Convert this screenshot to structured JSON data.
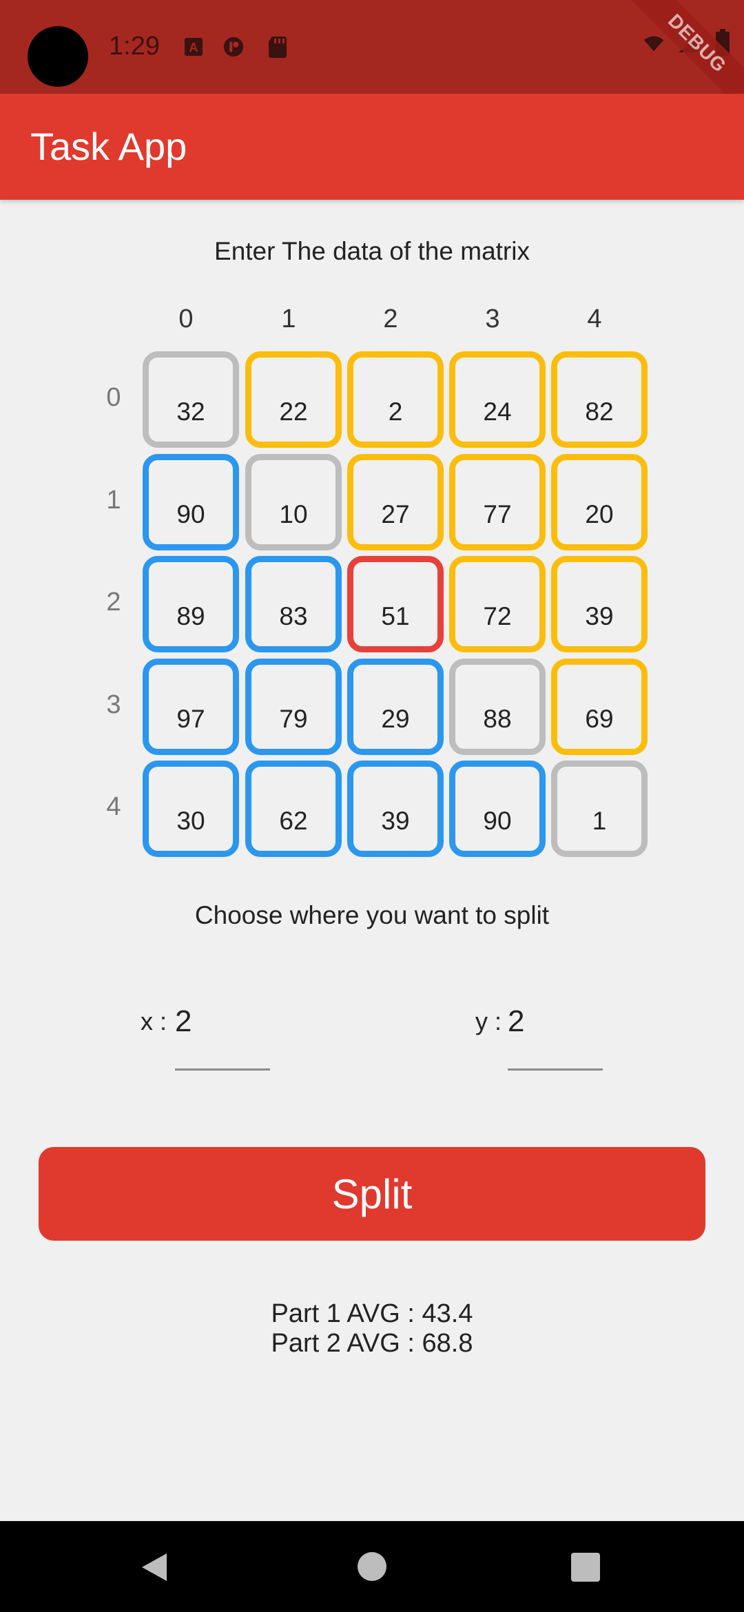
{
  "status_bar": {
    "time": "1:29",
    "left_icons": [
      "a-box-icon",
      "circle-app-icon",
      "sd-card-icon"
    ],
    "right_icons": [
      "wifi-icon",
      "signal-icon",
      "battery-icon"
    ],
    "debug_ribbon": "DEBUG"
  },
  "app_bar": {
    "title": "Task App"
  },
  "matrix": {
    "prompt": "Enter The data of the matrix",
    "column_labels": [
      "0",
      "1",
      "2",
      "3",
      "4"
    ],
    "row_labels": [
      "0",
      "1",
      "2",
      "3",
      "4"
    ],
    "rows": [
      [
        "32",
        "22",
        "2",
        "24",
        "82"
      ],
      [
        "90",
        "10",
        "27",
        "77",
        "20"
      ],
      [
        "89",
        "83",
        "51",
        "72",
        "39"
      ],
      [
        "97",
        "79",
        "29",
        "88",
        "69"
      ],
      [
        "30",
        "62",
        "39",
        "90",
        "1"
      ]
    ],
    "cell_colors": [
      [
        "gray",
        "yellow",
        "yellow",
        "yellow",
        "yellow"
      ],
      [
        "blue",
        "gray",
        "yellow",
        "yellow",
        "yellow"
      ],
      [
        "blue",
        "blue",
        "red",
        "yellow",
        "yellow"
      ],
      [
        "blue",
        "blue",
        "blue",
        "gray",
        "yellow"
      ],
      [
        "blue",
        "blue",
        "blue",
        "blue",
        "gray"
      ]
    ],
    "colors": {
      "gray": "#bdbdbd",
      "yellow": "#fbbd0d",
      "blue": "#2b97ee",
      "red": "#e6413a"
    }
  },
  "split": {
    "prompt": "Choose where you want to split",
    "x_label": "x :",
    "x_value": "2",
    "y_label": "y :",
    "y_value": "2",
    "button_label": "Split"
  },
  "results": {
    "part1": "Part 1 AVG : 43.4",
    "part2": "Part 2 AVG : 68.8"
  },
  "theme": {
    "primary": "#e0392e",
    "status_bar": "#a52820",
    "background": "#f0f0f0"
  }
}
